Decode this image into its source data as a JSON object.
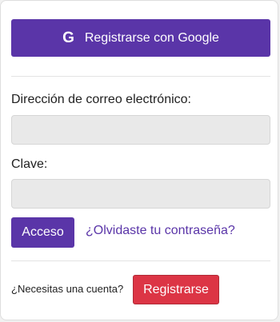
{
  "google_button": {
    "icon": "google-g-icon",
    "icon_glyph": "G",
    "label": "Registrarse con Google"
  },
  "form": {
    "email_label": "Dirección de correo electrónico:",
    "email_value": "",
    "password_label": "Clave:",
    "password_value": ""
  },
  "actions": {
    "login_label": "Acceso",
    "forgot_label": "¿Olvidaste tu contraseña?"
  },
  "footer": {
    "need_account_text": "¿Necesitas una cuenta?",
    "register_label": "Registrarse"
  },
  "colors": {
    "primary": "#5a35a8",
    "danger": "#dc3545"
  }
}
